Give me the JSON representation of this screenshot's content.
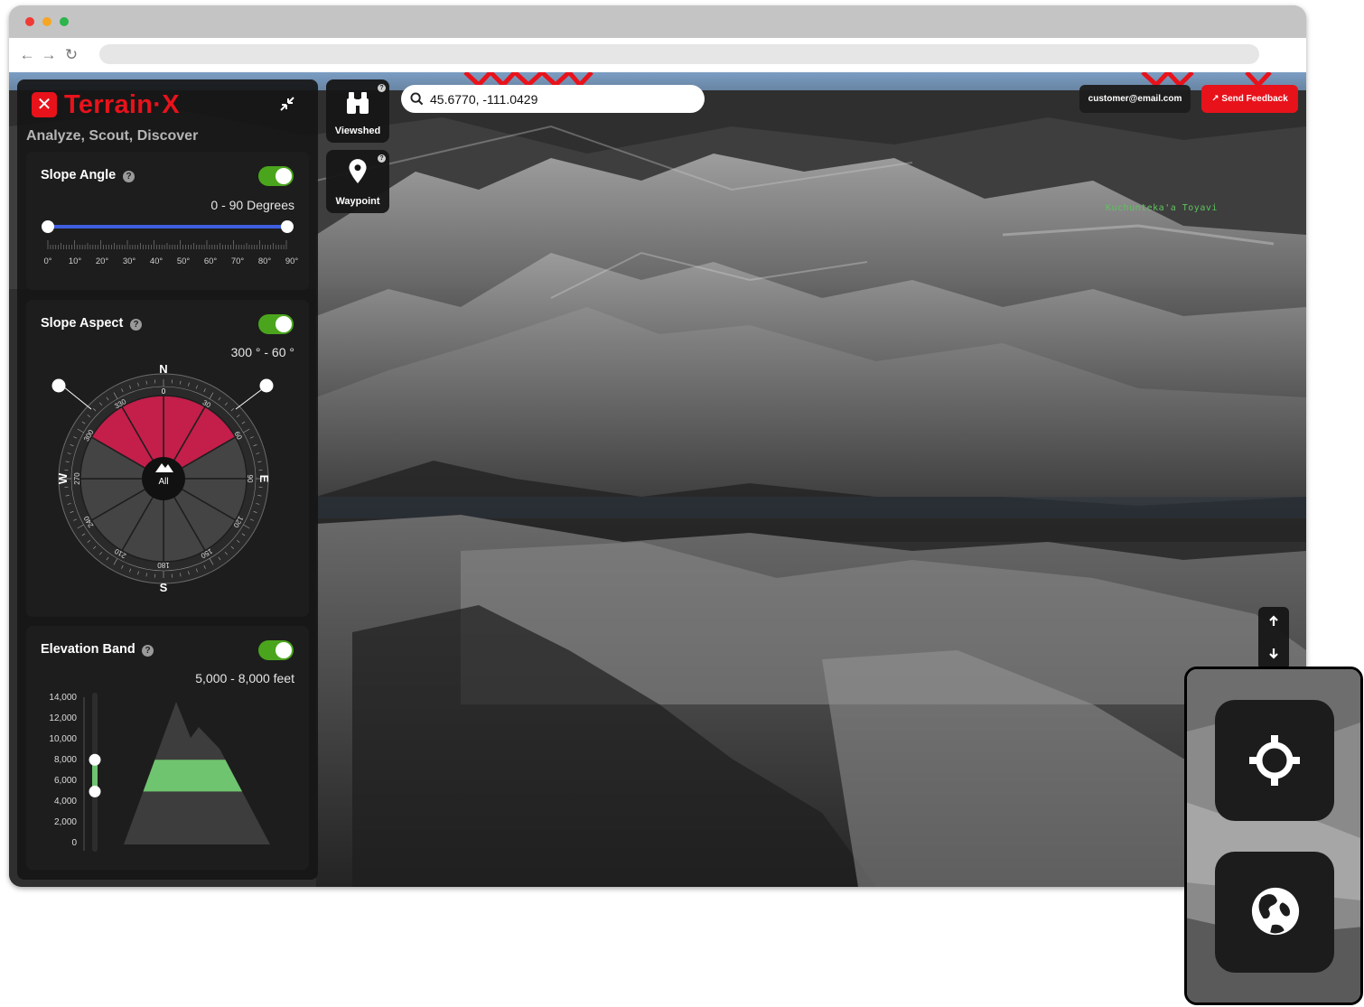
{
  "app": {
    "brand_name": "Terrain·X",
    "tagline": "Analyze, Scout, Discover"
  },
  "slope_angle": {
    "title": "Slope Angle",
    "range_text": "0 - 90 Degrees",
    "enabled": true,
    "min_value": 0,
    "max_value": 90,
    "tick_labels": [
      "0°",
      "10°",
      "20°",
      "30°",
      "40°",
      "50°",
      "60°",
      "70°",
      "80°",
      "90°"
    ]
  },
  "slope_aspect": {
    "title": "Slope Aspect",
    "range_text": "300 ° - 60 °",
    "enabled": true,
    "from_deg": 300,
    "to_deg": 60,
    "cardinals": {
      "n": "N",
      "e": "E",
      "s": "S",
      "w": "W"
    },
    "degree_labels": [
      "0",
      "30",
      "60",
      "90",
      "120",
      "150",
      "180",
      "210",
      "240",
      "270",
      "300",
      "330"
    ],
    "center_label": "All"
  },
  "elevation_band": {
    "title": "Elevation Band",
    "range_text": "5,000 - 8,000 feet",
    "enabled": true,
    "axis_labels": [
      "14,000",
      "12,000",
      "10,000",
      "8,000",
      "6,000",
      "4,000",
      "2,000",
      "0"
    ],
    "low_feet": 5000,
    "high_feet": 8000
  },
  "tools": {
    "viewshed_label": "Viewshed",
    "waypoint_label": "Waypoint"
  },
  "search": {
    "value": "45.6770, -111.0429"
  },
  "header": {
    "user_email": "customer@email.com",
    "feedback_label": "Send Feedback"
  },
  "map": {
    "place_label": "Kuchunteka'a Toyavi"
  },
  "colors": {
    "brand_red": "#e8121b",
    "toggle_green": "#4aa51c",
    "slider_blue": "#3f5fe0",
    "aspect_selected": "#c41e4a",
    "elevation_band": "#6fc46f",
    "panel_dark": "#1e1e1e"
  },
  "icons": {
    "viewshed": "binoculars-icon",
    "waypoint": "map-pin-icon",
    "search": "search-icon",
    "collapse": "collapse-icon",
    "locate": "crosshair-icon",
    "globe": "globe-icon"
  }
}
